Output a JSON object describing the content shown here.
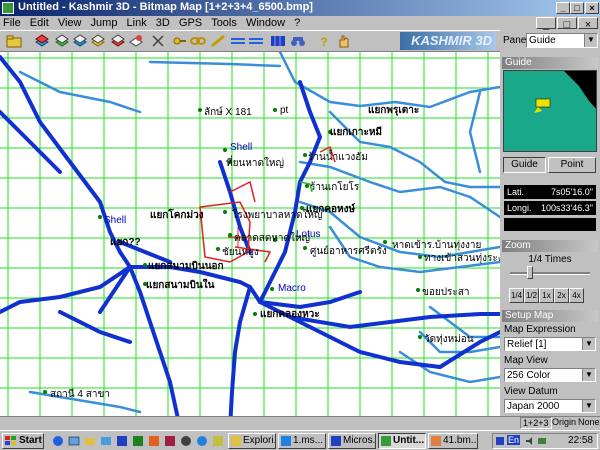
{
  "window": {
    "title": "Untitled - Kashmir 3D - Bitmap Map [1+2+3+4_6500.bmp]",
    "controls": {
      "minimize": "_",
      "maximize": "□",
      "close": "×"
    }
  },
  "menu": {
    "items": [
      "File",
      "Edit",
      "View",
      "Jump",
      "Link",
      "3D",
      "GPS",
      "Tools",
      "Window",
      "?"
    ]
  },
  "toolbar": {
    "brand": "KASHMIR 3D",
    "icons": [
      "open-folder-icon",
      "layers-icon",
      "map-icon",
      "map2-icon",
      "map3-icon",
      "map4-icon",
      "paint-icon",
      "scissors-icon",
      "key-icon",
      "link-icon",
      "ruler-icon",
      "route-icon",
      "route2-icon",
      "grid-icon",
      "binoculars-icon",
      "help-icon",
      "hand-icon"
    ]
  },
  "panel": {
    "selector_label": "Panel",
    "selector_value": "Guide",
    "guide_header": "Guide",
    "guide_tab": "Guide",
    "point_tab": "Point",
    "lat_label": "Lati.",
    "lat_value": "7s05'16.0\"",
    "long_label": "Longi.",
    "long_value": "100s33'46.3\"",
    "zoom_header": "Zoom",
    "zoom_value": "1/4 Times",
    "zoom_level": 0.25,
    "zoom_buttons": [
      "1/4",
      "1/2",
      "1x",
      "2x",
      "4x"
    ],
    "setup_header": "Setup Map",
    "map_expression_label": "Map Expression",
    "map_expression_value": "Relief [1]",
    "map_view_label": "Map View",
    "map_view_value": "256 Color",
    "view_datum_label": "View Datum",
    "view_datum_value": "Japan 2000"
  },
  "status": {
    "layers": "1+2+3",
    "origin": "Origin",
    "none": "None"
  },
  "taskbar": {
    "start": "Start",
    "tasks": [
      "Explori...",
      "1.ms...",
      "Micros...",
      "Untit...",
      "41.bm..."
    ],
    "clock": "22:58",
    "lang": "En"
  },
  "map_labels": {
    "l1": "ลักษ์ X 181",
    "l2": "pt",
    "l3": "แยกพรุเตาะ",
    "l4": "แยกเกาะหมี",
    "l5": "Shell",
    "l6": "ที่ยนหาดใหญ่",
    "l7": "ร้านน้ำแวงอัม",
    "l8": "ร้านเกโยโร",
    "l9": "Shell",
    "l10": "แยกโคกม่วง",
    "l11": "โรงพยาบาลหาดใหญ่",
    "l12": "แยกคอหงษ์",
    "l13": "Lotus",
    "l14": "ตลาดสดหาดใหญ่",
    "l15": "แยก??",
    "l16": "ชัยนหยูง",
    "l17": "ศูนย์อาหารศรีตรัง",
    "l18": "หาดเข้าร.บ้านทุ่งงาย",
    "l19": "ทางเข้าสวนทุ่งระงา",
    "l20": "แยกสนามบินนอก",
    "l21": "แยกสนามบินใน",
    "l22": "Macro",
    "l23": "ขอยประสา",
    "l24": "แยกคลองหวะ",
    "l25": "วัดทุ่งหม่อน",
    "l26": "สถานี 4 สาขา"
  }
}
